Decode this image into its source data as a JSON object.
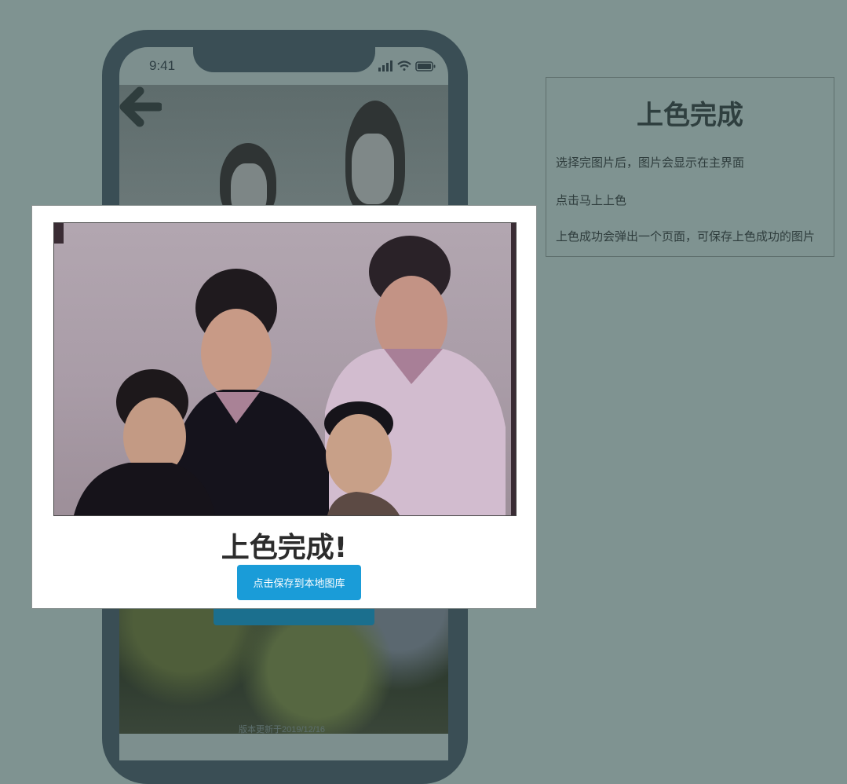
{
  "status_bar": {
    "time": "9:41"
  },
  "modal": {
    "title": "上色完成!",
    "save_label": "点击保存到本地图库"
  },
  "footer": {
    "version": "版本更新于2019/12/16"
  },
  "side_panel": {
    "title": "上色完成",
    "lines": [
      "选择完图片后，图片会显示在主界面",
      "点击马上上色",
      "上色成功会弹出一个页面，可保存上色成功的图片"
    ]
  },
  "colors": {
    "background": "#7f9391",
    "phone_frame": "#3a4e55",
    "save_button": "#1a9cd8"
  }
}
